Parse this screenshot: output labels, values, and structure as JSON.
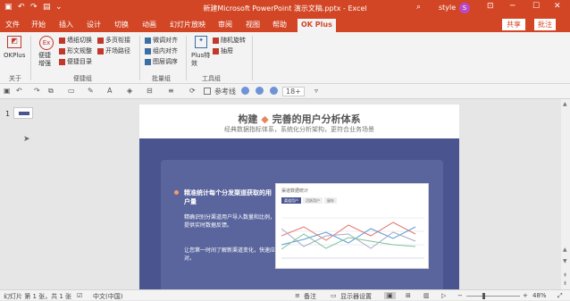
{
  "window": {
    "title": "新建Microsoft PowerPoint 演示文稿.pptx - Excel",
    "user": "style",
    "avatar_letter": "S"
  },
  "tabs": [
    "文件",
    "开始",
    "插入",
    "设计",
    "切换",
    "动画",
    "幻灯片放映",
    "审阅",
    "视图",
    "帮助",
    "OK Plus"
  ],
  "active_tab": "OK Plus",
  "actions": {
    "share": "共享",
    "comment": "批注"
  },
  "ribbon": {
    "okplus_label": "OKPlus",
    "about_group": "关于",
    "ex_label": "便捷增强",
    "items_col1": [
      "墙纸切换",
      "形文规整",
      "便捷目录"
    ],
    "items_col2": [
      "多页衔接",
      "开场路径"
    ],
    "group1_label": "便捷组",
    "items_col3": [
      "微调对齐",
      "组内对齐",
      "图层调序"
    ],
    "group2_label": "批量组",
    "plus_label": "Plus特效",
    "items_col4": [
      "随机旋转",
      "抽屉"
    ],
    "group3_label": "工具组"
  },
  "toolbar": {
    "guide_label": "参考线",
    "zoom_value": "18+"
  },
  "slide_num": "1",
  "slide": {
    "title_pre": "构建",
    "title_hl": "◆",
    "title_post": "完善的用户分析体系",
    "subtitle": "经典数据指标体系，系统化分析架构，更符合业务场景",
    "heading": "精准统计每个分发渠道获取的用户量",
    "para1": "精确识别分渠道用户导入数量和比例，并提供实时数据反馈。",
    "para2": "让您第一时间了解新渠道变化，快速应对。",
    "dash_title": "渠道数据统计",
    "dash_tabs": [
      "渠道用户",
      "活跃用户",
      "留存"
    ]
  },
  "status": {
    "slide_info": "幻灯片 第 1 张，共 1 张",
    "lang": "中文(中国)",
    "notes": "备注",
    "display": "显示器设置",
    "zoom": "48%"
  },
  "colors": {
    "accent": "#d24625",
    "slide_bg": "#4a5590",
    "card": "#5a659e"
  }
}
